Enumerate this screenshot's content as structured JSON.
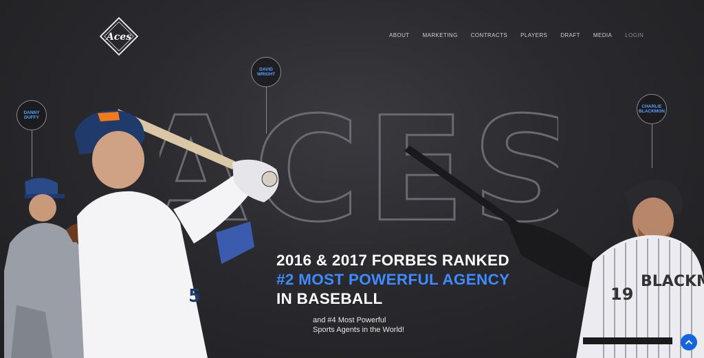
{
  "brand": {
    "logo_text": "Aces"
  },
  "nav": {
    "items": [
      {
        "label": "ABOUT"
      },
      {
        "label": "MARKETING"
      },
      {
        "label": "CONTRACTS"
      },
      {
        "label": "PLAYERS"
      },
      {
        "label": "DRAFT"
      },
      {
        "label": "MEDIA"
      },
      {
        "label": "LOGIN"
      }
    ]
  },
  "hero": {
    "bg_word": "ACES",
    "headline_line1": "2016 & 2017 FORBES RANKED",
    "headline_line2": "#2 MOST POWERFUL AGENCY",
    "headline_line3": "IN BASEBALL",
    "subtext_line1": "and #4 Most Powerful",
    "subtext_line2": "Sports Agents in the World!"
  },
  "players": [
    {
      "name_line1": "DANNY",
      "name_line2": "DUFFY"
    },
    {
      "name_line1": "DAVID",
      "name_line2": "WRIGHT"
    },
    {
      "name_line1": "CHARLIE",
      "name_line2": "BLACKMON"
    }
  ],
  "jerseys": {
    "wright_number": "5",
    "blackmon_name": "BLACKM",
    "blackmon_number": "19"
  },
  "colors": {
    "accent": "#3d8bff",
    "background": "#2a2a2e",
    "scroll_button": "#1466e0"
  },
  "icons": {
    "scroll_top": "chevron-up-icon"
  }
}
